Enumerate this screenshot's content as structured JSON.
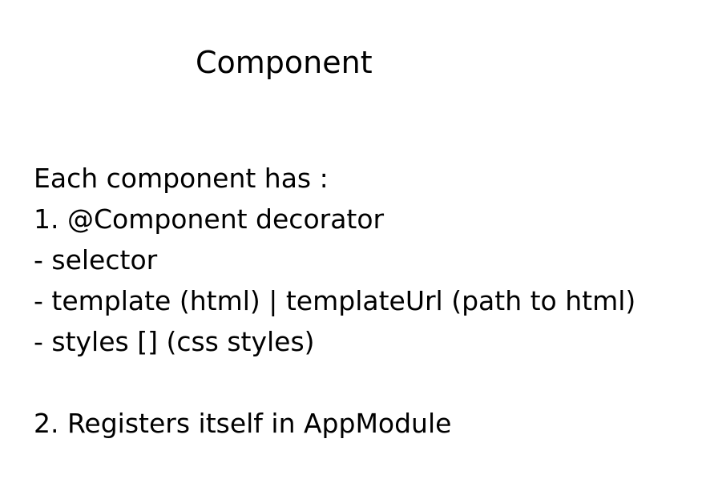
{
  "slide": {
    "title": "Component",
    "lines": [
      "Each component has :",
      "1. @Component decorator",
      "- selector",
      "- template (html) | templateUrl (path to html)",
      "- styles [] (css styles)",
      "",
      "2. Registers itself in AppModule"
    ]
  }
}
